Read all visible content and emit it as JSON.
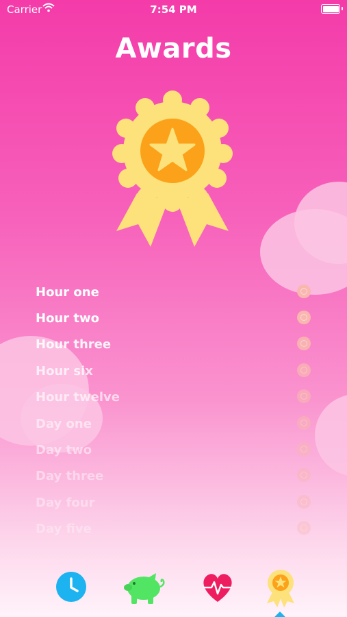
{
  "status_bar": {
    "carrier": "Carrier",
    "time": "7:54 PM"
  },
  "page": {
    "title": "Awards"
  },
  "awards": [
    {
      "label": "Hour one",
      "opacity": 1.0
    },
    {
      "label": "Hour two",
      "opacity": 1.0
    },
    {
      "label": "Hour three",
      "opacity": 0.9
    },
    {
      "label": "Hour six",
      "opacity": 0.7
    },
    {
      "label": "Hour twelve",
      "opacity": 0.6
    },
    {
      "label": "Day one",
      "opacity": 0.5
    },
    {
      "label": "Day two",
      "opacity": 0.45
    },
    {
      "label": "Day three",
      "opacity": 0.4
    },
    {
      "label": "Day four",
      "opacity": 0.35
    },
    {
      "label": "Day five",
      "opacity": 0.3
    }
  ],
  "tabs": [
    {
      "name": "clock-icon",
      "selected": false
    },
    {
      "name": "piggy-bank-icon",
      "selected": false
    },
    {
      "name": "heart-pulse-icon",
      "selected": false
    },
    {
      "name": "award-medal-icon",
      "selected": true
    }
  ],
  "colors": {
    "background_top": "#f43ba9",
    "background_bottom": "#fff3fa",
    "medal_gold": "#fde17b",
    "medal_orange": "#fca21a",
    "clock_blue": "#1db2f0",
    "piggy_green": "#52e564",
    "heart_red": "#ee1d60"
  }
}
